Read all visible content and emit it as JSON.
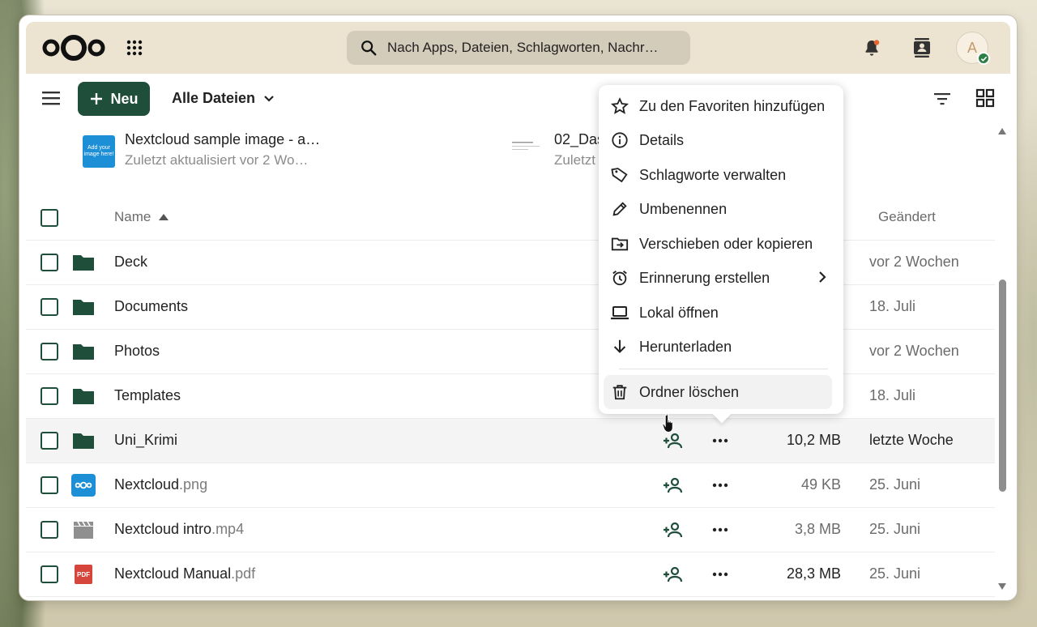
{
  "topbar": {
    "search_placeholder": "Nach Apps, Dateien, Schlagworten, Nachr…",
    "avatar_initial": "A"
  },
  "toolbar": {
    "new_label": "Neu",
    "breadcrumb": "Alle Dateien"
  },
  "recent": [
    {
      "name": "Nextcloud sample image - a…",
      "sub": "Zuletzt aktualisiert vor 2 Wo…",
      "thumb_text": "Add your image here!"
    },
    {
      "name": "02_Das",
      "sub": "Zuletzt"
    }
  ],
  "table": {
    "header": {
      "name": "Name",
      "modified": "Geändert"
    },
    "rows": [
      {
        "name": "Deck",
        "ext": "",
        "type": "folder",
        "size": "",
        "modified": "vor 2 Wochen"
      },
      {
        "name": "Documents",
        "ext": "",
        "type": "folder",
        "size": "",
        "modified": "18. Juli"
      },
      {
        "name": "Photos",
        "ext": "",
        "type": "folder",
        "size": "",
        "modified": "vor 2 Wochen"
      },
      {
        "name": "Templates",
        "ext": "",
        "type": "folder",
        "size": "",
        "modified": "18. Juli"
      },
      {
        "name": "Uni_Krimi",
        "ext": "",
        "type": "folder",
        "size": "10,2 MB",
        "modified": "letzte Woche"
      },
      {
        "name": "Nextcloud",
        "ext": ".png",
        "type": "image",
        "size": "49 KB",
        "modified": "25. Juni"
      },
      {
        "name": "Nextcloud intro",
        "ext": ".mp4",
        "type": "video",
        "size": "3,8 MB",
        "modified": "25. Juni"
      },
      {
        "name": "Nextcloud Manual",
        "ext": ".pdf",
        "type": "pdf",
        "size": "28,3 MB",
        "modified": "25. Juni"
      }
    ]
  },
  "context_menu": {
    "items": [
      {
        "label": "Zu den Favoriten hinzufügen",
        "icon": "star-icon"
      },
      {
        "label": "Details",
        "icon": "info-icon"
      },
      {
        "label": "Schlagworte verwalten",
        "icon": "tag-icon"
      },
      {
        "label": "Umbenennen",
        "icon": "pencil-icon"
      },
      {
        "label": "Verschieben oder kopieren",
        "icon": "folder-move-icon"
      },
      {
        "label": "Erinnerung erstellen",
        "icon": "alarm-icon"
      },
      {
        "label": "Lokal öffnen",
        "icon": "laptop-icon"
      },
      {
        "label": "Herunterladen",
        "icon": "download-icon"
      },
      {
        "label": "Ordner löschen",
        "icon": "trash-icon"
      }
    ]
  },
  "colors": {
    "primary": "#1f4e3b",
    "header_bg": "#ece3d0",
    "search_bg": "#d4ccba"
  }
}
